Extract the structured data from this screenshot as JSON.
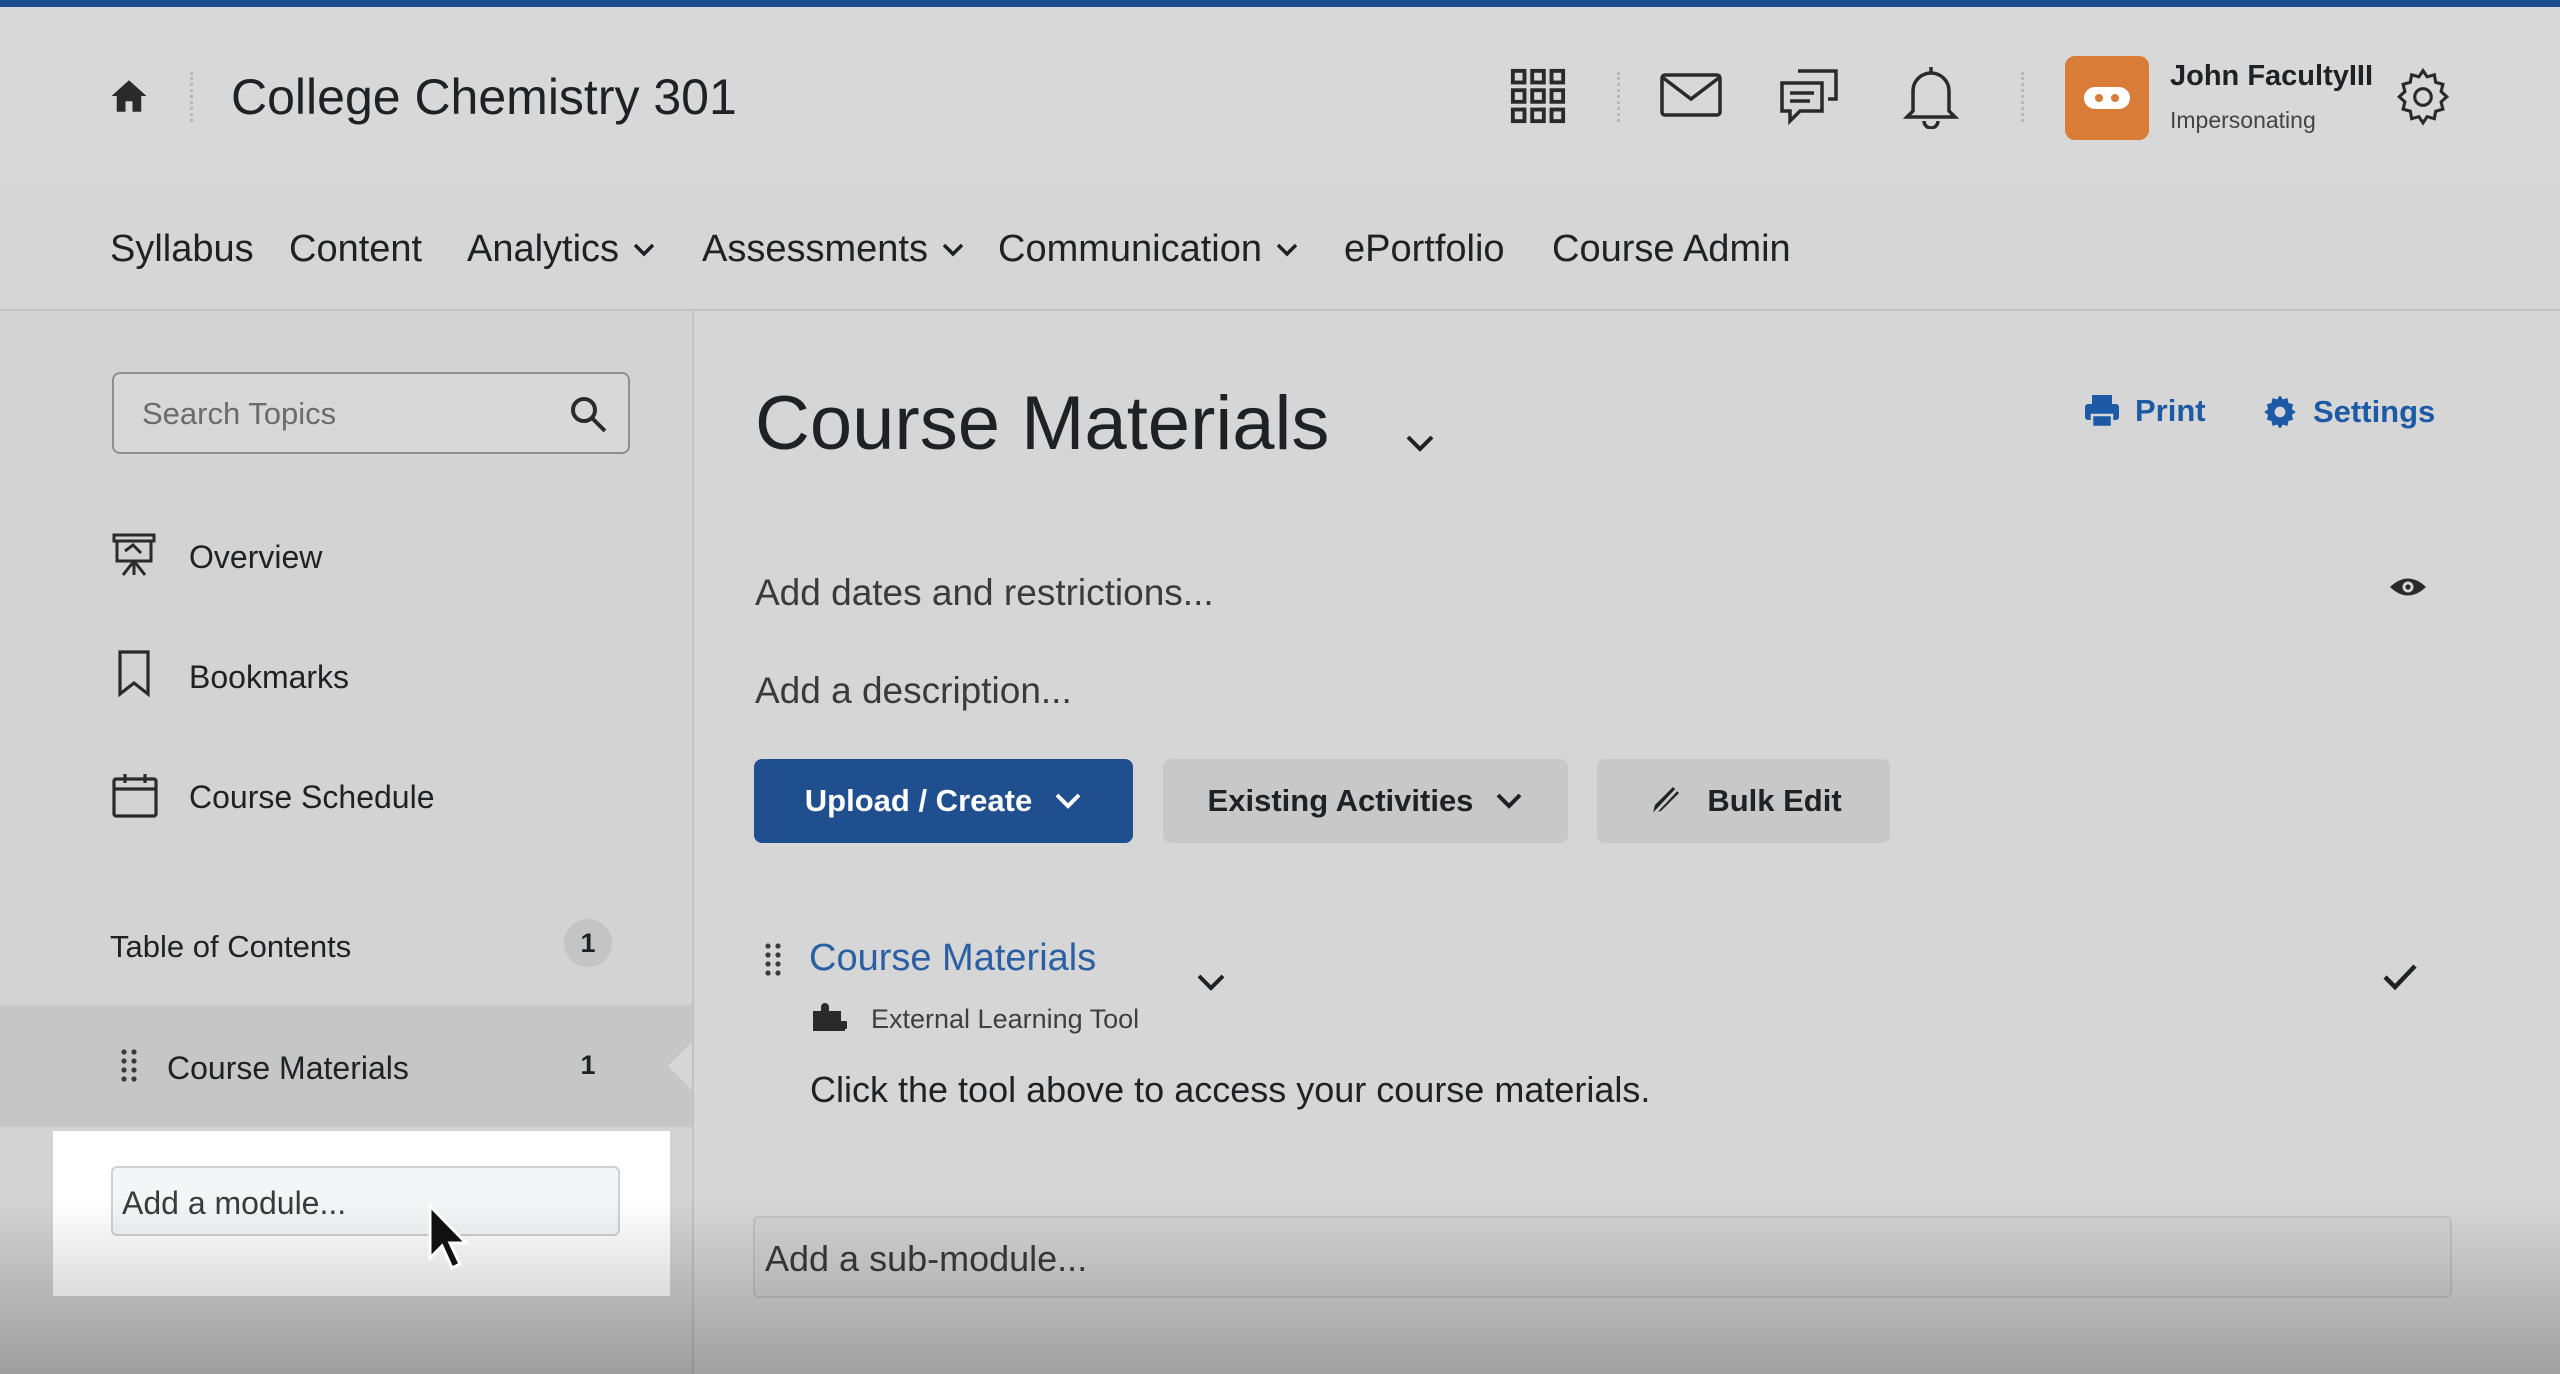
{
  "header": {
    "course_title": "College Chemistry 301",
    "user": {
      "name": "John FacultyIII",
      "status": "Impersonating"
    },
    "icons": [
      "home-icon",
      "apps-grid-icon",
      "mail-icon",
      "chat-icon",
      "bell-icon",
      "avatar-icon",
      "gear-icon"
    ]
  },
  "nav": {
    "items": [
      {
        "label": "Syllabus",
        "dropdown": false
      },
      {
        "label": "Content",
        "dropdown": false
      },
      {
        "label": "Analytics",
        "dropdown": true
      },
      {
        "label": "Assessments",
        "dropdown": true
      },
      {
        "label": "Communication",
        "dropdown": true
      },
      {
        "label": "ePortfolio",
        "dropdown": false
      },
      {
        "label": "Course Admin",
        "dropdown": false
      }
    ]
  },
  "sidebar": {
    "search_placeholder": "Search Topics",
    "overview": "Overview",
    "bookmarks": "Bookmarks",
    "course_schedule": "Course Schedule",
    "toc": {
      "label": "Table of Contents",
      "count": "1"
    },
    "module": {
      "label": "Course Materials",
      "count": "1"
    },
    "add_module": "Add a module..."
  },
  "main": {
    "title": "Course Materials",
    "print_label": "Print",
    "settings_label": "Settings",
    "add_dates": "Add dates and restrictions...",
    "add_description": "Add a description...",
    "buttons": {
      "upload_create": "Upload / Create",
      "existing_activities": "Existing Activities",
      "bulk_edit": "Bulk Edit"
    },
    "topic": {
      "title": "Course Materials",
      "type": "External Learning Tool",
      "description": "Click the tool above to access your course materials."
    },
    "add_submodule": "Add a sub-module..."
  },
  "colors": {
    "accent": "#1f4f8e",
    "link": "#1c5aa6",
    "avatar": "#d97c38",
    "top_line": "#1d4f8f"
  }
}
